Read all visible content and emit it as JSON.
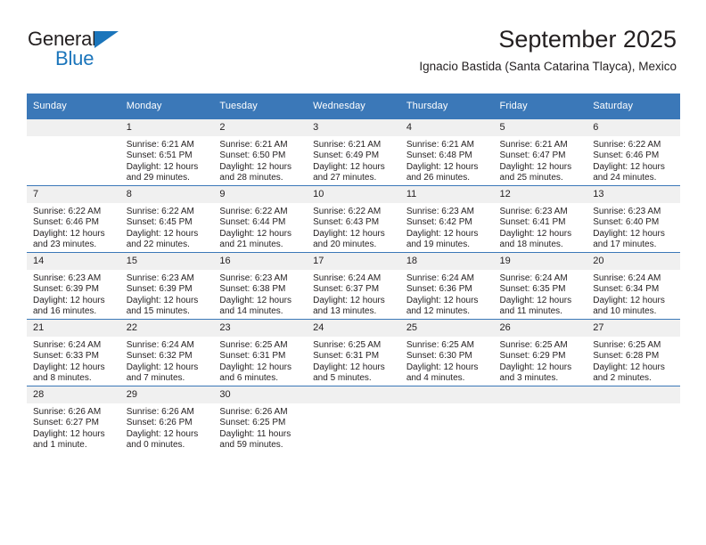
{
  "brand": {
    "name_top": "General",
    "name_bottom": "Blue",
    "accent_color": "#1b75bb"
  },
  "header": {
    "title": "September 2025",
    "location": "Ignacio Bastida (Santa Catarina Tlayca), Mexico",
    "header_bg": "#3b78b8",
    "daynum_bg": "#f0f0f0"
  },
  "calendar": {
    "weekday_headers": [
      "Sunday",
      "Monday",
      "Tuesday",
      "Wednesday",
      "Thursday",
      "Friday",
      "Saturday"
    ],
    "weeks": [
      [
        {
          "day": "",
          "empty": true
        },
        {
          "day": "1",
          "sunrise": "Sunrise: 6:21 AM",
          "sunset": "Sunset: 6:51 PM",
          "daylight1": "Daylight: 12 hours",
          "daylight2": "and 29 minutes."
        },
        {
          "day": "2",
          "sunrise": "Sunrise: 6:21 AM",
          "sunset": "Sunset: 6:50 PM",
          "daylight1": "Daylight: 12 hours",
          "daylight2": "and 28 minutes."
        },
        {
          "day": "3",
          "sunrise": "Sunrise: 6:21 AM",
          "sunset": "Sunset: 6:49 PM",
          "daylight1": "Daylight: 12 hours",
          "daylight2": "and 27 minutes."
        },
        {
          "day": "4",
          "sunrise": "Sunrise: 6:21 AM",
          "sunset": "Sunset: 6:48 PM",
          "daylight1": "Daylight: 12 hours",
          "daylight2": "and 26 minutes."
        },
        {
          "day": "5",
          "sunrise": "Sunrise: 6:21 AM",
          "sunset": "Sunset: 6:47 PM",
          "daylight1": "Daylight: 12 hours",
          "daylight2": "and 25 minutes."
        },
        {
          "day": "6",
          "sunrise": "Sunrise: 6:22 AM",
          "sunset": "Sunset: 6:46 PM",
          "daylight1": "Daylight: 12 hours",
          "daylight2": "and 24 minutes."
        }
      ],
      [
        {
          "day": "7",
          "sunrise": "Sunrise: 6:22 AM",
          "sunset": "Sunset: 6:46 PM",
          "daylight1": "Daylight: 12 hours",
          "daylight2": "and 23 minutes."
        },
        {
          "day": "8",
          "sunrise": "Sunrise: 6:22 AM",
          "sunset": "Sunset: 6:45 PM",
          "daylight1": "Daylight: 12 hours",
          "daylight2": "and 22 minutes."
        },
        {
          "day": "9",
          "sunrise": "Sunrise: 6:22 AM",
          "sunset": "Sunset: 6:44 PM",
          "daylight1": "Daylight: 12 hours",
          "daylight2": "and 21 minutes."
        },
        {
          "day": "10",
          "sunrise": "Sunrise: 6:22 AM",
          "sunset": "Sunset: 6:43 PM",
          "daylight1": "Daylight: 12 hours",
          "daylight2": "and 20 minutes."
        },
        {
          "day": "11",
          "sunrise": "Sunrise: 6:23 AM",
          "sunset": "Sunset: 6:42 PM",
          "daylight1": "Daylight: 12 hours",
          "daylight2": "and 19 minutes."
        },
        {
          "day": "12",
          "sunrise": "Sunrise: 6:23 AM",
          "sunset": "Sunset: 6:41 PM",
          "daylight1": "Daylight: 12 hours",
          "daylight2": "and 18 minutes."
        },
        {
          "day": "13",
          "sunrise": "Sunrise: 6:23 AM",
          "sunset": "Sunset: 6:40 PM",
          "daylight1": "Daylight: 12 hours",
          "daylight2": "and 17 minutes."
        }
      ],
      [
        {
          "day": "14",
          "sunrise": "Sunrise: 6:23 AM",
          "sunset": "Sunset: 6:39 PM",
          "daylight1": "Daylight: 12 hours",
          "daylight2": "and 16 minutes."
        },
        {
          "day": "15",
          "sunrise": "Sunrise: 6:23 AM",
          "sunset": "Sunset: 6:39 PM",
          "daylight1": "Daylight: 12 hours",
          "daylight2": "and 15 minutes."
        },
        {
          "day": "16",
          "sunrise": "Sunrise: 6:23 AM",
          "sunset": "Sunset: 6:38 PM",
          "daylight1": "Daylight: 12 hours",
          "daylight2": "and 14 minutes."
        },
        {
          "day": "17",
          "sunrise": "Sunrise: 6:24 AM",
          "sunset": "Sunset: 6:37 PM",
          "daylight1": "Daylight: 12 hours",
          "daylight2": "and 13 minutes."
        },
        {
          "day": "18",
          "sunrise": "Sunrise: 6:24 AM",
          "sunset": "Sunset: 6:36 PM",
          "daylight1": "Daylight: 12 hours",
          "daylight2": "and 12 minutes."
        },
        {
          "day": "19",
          "sunrise": "Sunrise: 6:24 AM",
          "sunset": "Sunset: 6:35 PM",
          "daylight1": "Daylight: 12 hours",
          "daylight2": "and 11 minutes."
        },
        {
          "day": "20",
          "sunrise": "Sunrise: 6:24 AM",
          "sunset": "Sunset: 6:34 PM",
          "daylight1": "Daylight: 12 hours",
          "daylight2": "and 10 minutes."
        }
      ],
      [
        {
          "day": "21",
          "sunrise": "Sunrise: 6:24 AM",
          "sunset": "Sunset: 6:33 PM",
          "daylight1": "Daylight: 12 hours",
          "daylight2": "and 8 minutes."
        },
        {
          "day": "22",
          "sunrise": "Sunrise: 6:24 AM",
          "sunset": "Sunset: 6:32 PM",
          "daylight1": "Daylight: 12 hours",
          "daylight2": "and 7 minutes."
        },
        {
          "day": "23",
          "sunrise": "Sunrise: 6:25 AM",
          "sunset": "Sunset: 6:31 PM",
          "daylight1": "Daylight: 12 hours",
          "daylight2": "and 6 minutes."
        },
        {
          "day": "24",
          "sunrise": "Sunrise: 6:25 AM",
          "sunset": "Sunset: 6:31 PM",
          "daylight1": "Daylight: 12 hours",
          "daylight2": "and 5 minutes."
        },
        {
          "day": "25",
          "sunrise": "Sunrise: 6:25 AM",
          "sunset": "Sunset: 6:30 PM",
          "daylight1": "Daylight: 12 hours",
          "daylight2": "and 4 minutes."
        },
        {
          "day": "26",
          "sunrise": "Sunrise: 6:25 AM",
          "sunset": "Sunset: 6:29 PM",
          "daylight1": "Daylight: 12 hours",
          "daylight2": "and 3 minutes."
        },
        {
          "day": "27",
          "sunrise": "Sunrise: 6:25 AM",
          "sunset": "Sunset: 6:28 PM",
          "daylight1": "Daylight: 12 hours",
          "daylight2": "and 2 minutes."
        }
      ],
      [
        {
          "day": "28",
          "sunrise": "Sunrise: 6:26 AM",
          "sunset": "Sunset: 6:27 PM",
          "daylight1": "Daylight: 12 hours",
          "daylight2": "and 1 minute."
        },
        {
          "day": "29",
          "sunrise": "Sunrise: 6:26 AM",
          "sunset": "Sunset: 6:26 PM",
          "daylight1": "Daylight: 12 hours",
          "daylight2": "and 0 minutes."
        },
        {
          "day": "30",
          "sunrise": "Sunrise: 6:26 AM",
          "sunset": "Sunset: 6:25 PM",
          "daylight1": "Daylight: 11 hours",
          "daylight2": "and 59 minutes."
        },
        {
          "day": "",
          "empty": true
        },
        {
          "day": "",
          "empty": true
        },
        {
          "day": "",
          "empty": true
        },
        {
          "day": "",
          "empty": true
        }
      ]
    ]
  }
}
